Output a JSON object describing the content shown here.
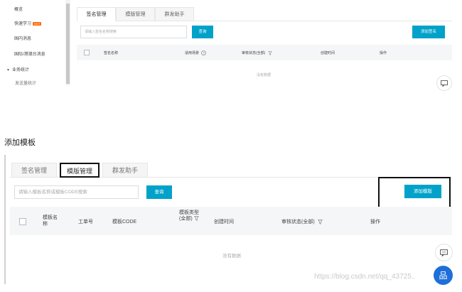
{
  "top_panel": {
    "sidebar": {
      "items": [
        {
          "label": "概览"
        },
        {
          "label": "快速学习",
          "badge": "HOT"
        },
        {
          "label": "国内消息"
        },
        {
          "label": "国际/港澳台消息"
        },
        {
          "label": "业务统计",
          "expanded": true
        },
        {
          "label": "发送量统计"
        }
      ]
    },
    "tabs": [
      {
        "label": "签名管理",
        "active": true
      },
      {
        "label": "模版管理",
        "active": false
      },
      {
        "label": "群发助手",
        "active": false
      }
    ],
    "search": {
      "placeholder": "请输入签名名称搜索",
      "button_label": "查询"
    },
    "add_button_label": "添加签名",
    "table": {
      "columns": [
        "签名名称",
        "适用场景",
        "审核状态(全部)",
        "创建时间",
        "操作"
      ],
      "empty_text": "没有数据"
    }
  },
  "section_title": "添加模板",
  "bottom_panel": {
    "tabs": [
      {
        "label": "签名管理",
        "active": false
      },
      {
        "label": "模版管理",
        "active": true
      },
      {
        "label": "群发助手",
        "active": false
      }
    ],
    "search": {
      "placeholder": "请输入模板名称或模板CODE搜索",
      "button_label": "查询"
    },
    "add_button_label": "添加模版",
    "table": {
      "columns": [
        "模板名称",
        "工单号",
        "模板CODE",
        "模板类型(全部)",
        "创建时间",
        "审核状态(全部)",
        "操作"
      ],
      "empty_text": "没有数据"
    },
    "assist_label": "品"
  },
  "watermark": "https://blog.csdn.net/qq_43725..",
  "colors": {
    "accent": "#00a2ca",
    "table_header_bg": "#f5f6f8",
    "highlight_border": "#111111"
  },
  "icons": [
    "chat-icon",
    "help-circle-icon",
    "filter-icon",
    "assistant-icon"
  ]
}
